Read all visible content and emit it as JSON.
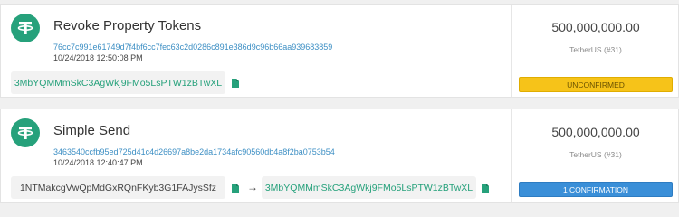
{
  "transactions": [
    {
      "title": "Revoke Property Tokens",
      "hash": "76cc7c991e61749d7f4bf6cc7fec63c2d0286c891e386d9c96b66aa939683859",
      "date": "10/24/2018 12:50:08 PM",
      "address": "3MbYQMMmSkC3AgWkj9FMo5LsPTW1zBTwXL",
      "amount": "500,000,000.00",
      "property": "TetherUS (#31)",
      "status": "UNCONFIRMED"
    },
    {
      "title": "Simple Send",
      "hash": "3463540ccfb95ed725d41c4d26697a8be2da1734afc90560db4a8f2ba0753b54",
      "date": "10/24/2018 12:40:47 PM",
      "from_address": "1NTMakcgVwQpMdGxRQnFKyb3G1FAJysSfz",
      "arrow": "→",
      "to_address": "3MbYQMMmSkC3AgWkj9FMo5LsPTW1zBTwXL",
      "amount": "500,000,000.00",
      "property": "TetherUS (#31)",
      "status": "1 CONFIRMATION"
    }
  ],
  "colors": {
    "tether_green": "#26a17b",
    "link_blue": "#3d8fc4",
    "unconfirmed_yellow": "#f6c319",
    "confirmed_blue": "#3a8fd8"
  },
  "icons": {
    "logo": "tether-logo",
    "copy": "copy-icon"
  }
}
